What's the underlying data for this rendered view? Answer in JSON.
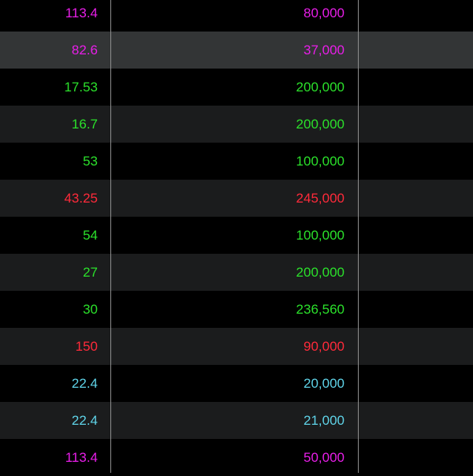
{
  "colors": {
    "magenta": "#e81ee8",
    "green": "#2be02b",
    "red": "#ff2a3a",
    "cyan": "#5fd3e8",
    "background": "#000000",
    "row_alt": "#1b1c1d",
    "row_selected": "#333536",
    "divider": "#8e8e8e"
  },
  "rows": [
    {
      "price": "113.4",
      "volume": "80,000",
      "color": "magenta",
      "shade": "plain"
    },
    {
      "price": "82.6",
      "volume": "37,000",
      "color": "magenta",
      "shade": "selected"
    },
    {
      "price": "17.53",
      "volume": "200,000",
      "color": "green",
      "shade": "plain"
    },
    {
      "price": "16.7",
      "volume": "200,000",
      "color": "green",
      "shade": "alt"
    },
    {
      "price": "53",
      "volume": "100,000",
      "color": "green",
      "shade": "plain"
    },
    {
      "price": "43.25",
      "volume": "245,000",
      "color": "red",
      "shade": "alt"
    },
    {
      "price": "54",
      "volume": "100,000",
      "color": "green",
      "shade": "plain"
    },
    {
      "price": "27",
      "volume": "200,000",
      "color": "green",
      "shade": "alt"
    },
    {
      "price": "30",
      "volume": "236,560",
      "color": "green",
      "shade": "plain"
    },
    {
      "price": "150",
      "volume": "90,000",
      "color": "red",
      "shade": "alt"
    },
    {
      "price": "22.4",
      "volume": "20,000",
      "color": "cyan",
      "shade": "plain"
    },
    {
      "price": "22.4",
      "volume": "21,000",
      "color": "cyan",
      "shade": "alt"
    },
    {
      "price": "113.4",
      "volume": "50,000",
      "color": "magenta",
      "shade": "plain"
    }
  ]
}
